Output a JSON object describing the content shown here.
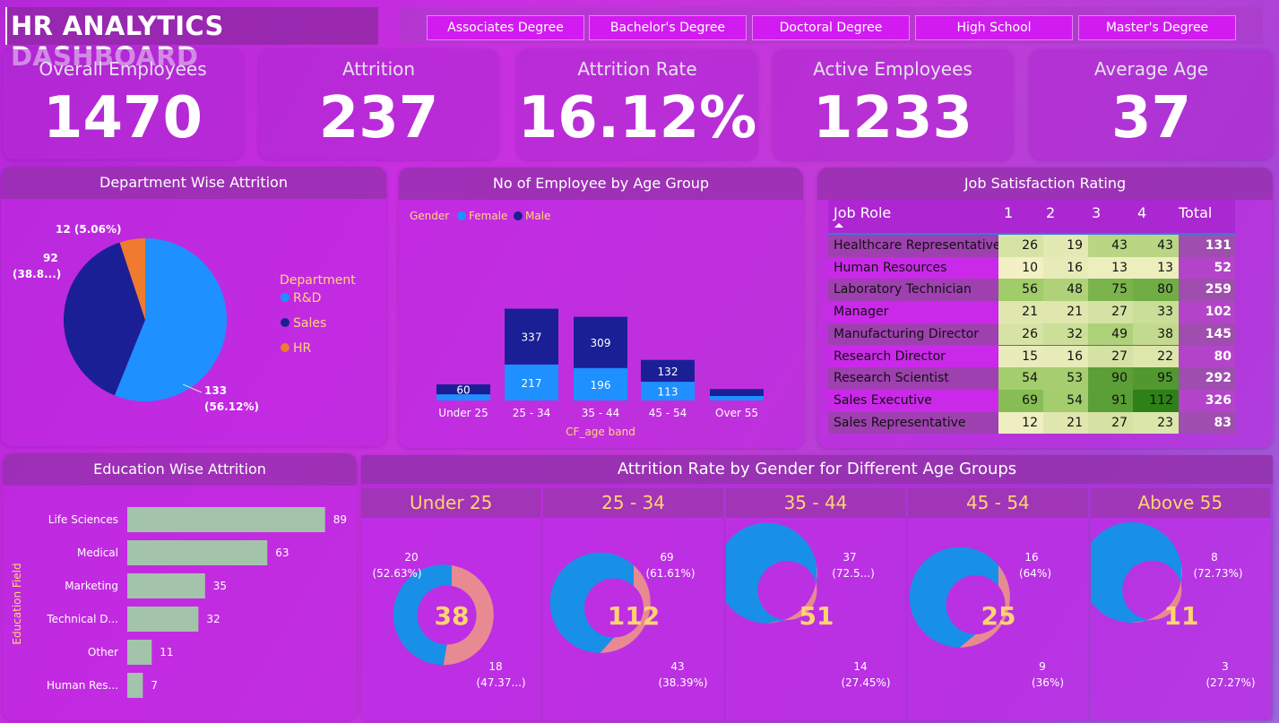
{
  "header": {
    "title": "HR ANALYTICS DASHBOARD"
  },
  "slicer": {
    "options": [
      "Associates Degree",
      "Bachelor's Degree",
      "Doctoral Degree",
      "High School",
      "Master's Degree"
    ]
  },
  "kpis": [
    {
      "label": "Overall Employees",
      "value": "1470"
    },
    {
      "label": "Attrition",
      "value": "237"
    },
    {
      "label": "Attrition Rate",
      "value": "16.12%"
    },
    {
      "label": "Active Employees",
      "value": "1233"
    },
    {
      "label": "Average Age",
      "value": "37"
    }
  ],
  "dept": {
    "title": "Department Wise Attrition",
    "legend_title": "Department",
    "labels": {
      "rd": "133",
      "rd_pct": "(56.12%)",
      "sales": "92",
      "sales_pct": "(38.8...)",
      "hr": "12 (5.06%)"
    }
  },
  "age_group": {
    "title": "No of Employee by Age Group",
    "legend_title": "Gender",
    "xlabel": "CF_age band"
  },
  "job_sat": {
    "title": "Job Satisfaction Rating",
    "col_header": "Job Role",
    "columns": [
      "1",
      "2",
      "3",
      "4",
      "Total"
    ]
  },
  "education": {
    "title": "Education Wise Attrition",
    "ylabel": "Education Field"
  },
  "gender_age": {
    "title": "Attrition Rate by Gender for Different Age Groups"
  },
  "colors": {
    "female": "#1e90ff",
    "male": "#1a1f96",
    "hr": "#f07a30",
    "donut_female": "#1890e8",
    "donut_male": "#e88a92",
    "edu_bar": "#a3c3aa"
  },
  "chart_data": [
    {
      "type": "pie",
      "id": "dept",
      "title": "Department Wise Attrition",
      "legend": "right",
      "series": [
        {
          "name": "R&D",
          "value": 133,
          "label": "133 (56.12%)"
        },
        {
          "name": "Sales",
          "value": 92,
          "label": "92 (38.8...)"
        },
        {
          "name": "HR",
          "value": 12,
          "label": "12 (5.06%)"
        }
      ]
    },
    {
      "type": "bar",
      "id": "age",
      "stacked": true,
      "title": "No of Employee by Age Group",
      "xlabel": "CF_age band",
      "legend": "top-left",
      "categories": [
        "Under 25",
        "25 - 34",
        "35 - 44",
        "45 - 54",
        "Over 55"
      ],
      "series": [
        {
          "name": "Female",
          "values": [
            37,
            217,
            196,
            113,
            27
          ]
        },
        {
          "name": "Male",
          "values": [
            60,
            337,
            309,
            132,
            42
          ]
        }
      ],
      "data_labels": {
        "Female": [
          "",
          "217",
          "196",
          "113",
          ""
        ],
        "Male": [
          "60",
          "337",
          "309",
          "132",
          ""
        ]
      }
    },
    {
      "type": "table",
      "id": "jobsat",
      "title": "Job Satisfaction Rating",
      "columns": [
        "Job Role",
        "1",
        "2",
        "3",
        "4",
        "Total"
      ],
      "rows": [
        [
          "Healthcare Representative",
          26,
          19,
          43,
          43,
          131
        ],
        [
          "Human Resources",
          10,
          16,
          13,
          13,
          52
        ],
        [
          "Laboratory Technician",
          56,
          48,
          75,
          80,
          259
        ],
        [
          "Manager",
          21,
          21,
          27,
          33,
          102
        ],
        [
          "Manufacturing Director",
          26,
          32,
          49,
          38,
          145
        ],
        [
          "Research Director",
          15,
          16,
          27,
          22,
          80
        ],
        [
          "Research Scientist",
          54,
          53,
          90,
          95,
          292
        ],
        [
          "Sales Executive",
          69,
          54,
          91,
          112,
          326
        ],
        [
          "Sales Representative",
          12,
          21,
          27,
          23,
          83
        ]
      ]
    },
    {
      "type": "bar",
      "id": "edu",
      "orientation": "horizontal",
      "title": "Education Wise Attrition",
      "ylabel": "Education Field",
      "categories": [
        "Life Sciences",
        "Medical",
        "Marketing",
        "Technical D...",
        "Other",
        "Human Res..."
      ],
      "values": [
        89,
        63,
        35,
        32,
        11,
        7
      ]
    },
    {
      "type": "pie",
      "id": "donuts",
      "donut": true,
      "title": "Attrition Rate by Gender for Different Age Groups",
      "groups": [
        {
          "label": "Under 25",
          "total": "38",
          "female": 20,
          "male": 18,
          "female_label": "20",
          "female_pct": "(52.63%)",
          "male_label": "18",
          "male_pct": "(47.37...)"
        },
        {
          "label": "25 - 34",
          "total": "112",
          "female": 69,
          "male": 43,
          "female_label": "69",
          "female_pct": "(61.61%)",
          "male_label": "43",
          "male_pct": "(38.39%)"
        },
        {
          "label": "35 - 44",
          "total": "51",
          "female": 37,
          "male": 14,
          "female_label": "37",
          "female_pct": "(72.5...)",
          "male_label": "14",
          "male_pct": "(27.45%)"
        },
        {
          "label": "45 - 54",
          "total": "25",
          "female": 16,
          "male": 9,
          "female_label": "16",
          "female_pct": "(64%)",
          "male_label": "9",
          "male_pct": "(36%)"
        },
        {
          "label": "Above 55",
          "total": "11",
          "female": 8,
          "male": 3,
          "female_label": "8",
          "female_pct": "(72.73%)",
          "male_label": "3",
          "male_pct": "(27.27%)"
        }
      ]
    }
  ]
}
